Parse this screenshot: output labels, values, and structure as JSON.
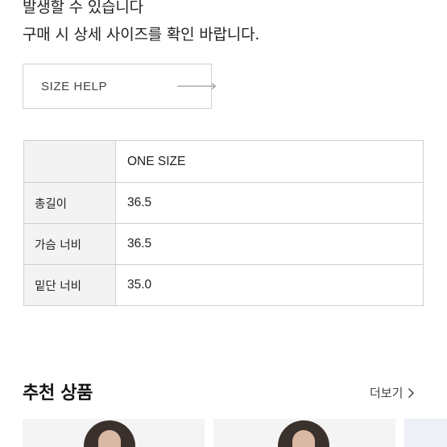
{
  "notice": {
    "line1": "발생할 수 있습니다",
    "line2": "구매 시 상세 사이즈를 확인 바랍니다."
  },
  "size_help": {
    "label": "SIZE HELP",
    "icon": "arrow-right-icon"
  },
  "size_table": {
    "columns": [
      "",
      "ONE SIZE"
    ],
    "rows": [
      {
        "label": "총길이",
        "value": "36.5"
      },
      {
        "label": "가슴 너비",
        "value": "36.5"
      },
      {
        "label": "밑단 너비",
        "value": "35.0"
      }
    ]
  },
  "recommended": {
    "title": "추천 상품",
    "more_label": "더보기",
    "more_icon": "chevron-right-icon"
  },
  "colors": {
    "border": "#cfcfcf",
    "header_bg": "#f3f3f3",
    "text": "#222222"
  }
}
